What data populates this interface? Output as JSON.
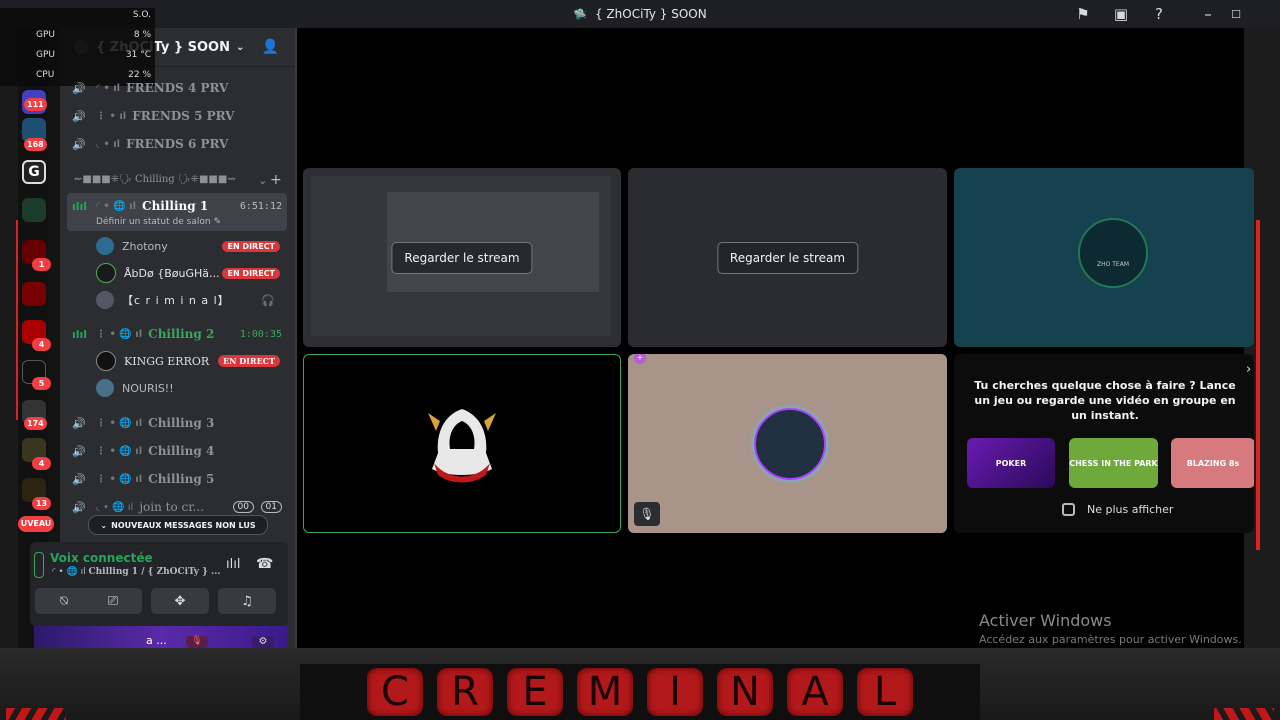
{
  "window": {
    "title": "{ ZhOCiTy } SOON"
  },
  "hardware_overlay": {
    "rows": [
      {
        "key": "",
        "value": "S.O."
      },
      {
        "key": "GPU",
        "value": "8 %"
      },
      {
        "key": "GPU",
        "value": "31 °C"
      },
      {
        "key": "CPU",
        "value": "22 %"
      }
    ]
  },
  "servers": {
    "badges": [
      "111",
      "168",
      "1",
      "4",
      "5",
      "174",
      "4",
      "13"
    ],
    "nouveau": "UVEAU"
  },
  "guild": {
    "name": "{ ZhOCiTy } SOON"
  },
  "channels": {
    "prv": [
      "FRENDS 4 PRV",
      "FRENDS 5 PRV",
      "FRENDS 6 PRV"
    ],
    "category": "⇜■■■⁜🗣 Chilling 🗣⁜■■■⇝",
    "chilling1": {
      "name": "Chilling 1",
      "time": "6:51:12",
      "status": "Définir un statut de salon"
    },
    "chilling1_users": [
      {
        "name": "Zhotony",
        "live": "EN DIRECT"
      },
      {
        "name": "ÅbDø {BøuGHä...",
        "live": "EN DIRECT"
      },
      {
        "name": "【c r i m i n a l】",
        "live": ""
      }
    ],
    "chilling2": {
      "name": "Chilling 2",
      "time": "1:00:35"
    },
    "chilling2_users": [
      {
        "name": "KINGG ERROR",
        "live": "EN DIRECT"
      },
      {
        "name": "NOURIS!!",
        "live": ""
      }
    ],
    "others": [
      "Chilling 3",
      "Chilling 4",
      "Chilling 5"
    ],
    "join": {
      "name": "join to cr...",
      "count1": "00",
      "count2": "01"
    },
    "unread": "NOUVEAUX MESSAGES NON LUS"
  },
  "voice": {
    "status": "Voix connectée",
    "channel": "Chilling 1 / { ZhOCiTy } ...",
    "profile_name": "a ..."
  },
  "stage": {
    "watch_label": "Regarder le stream",
    "activity_title": "Tu cherches quelque chose à faire ? Lance un jeu ou regarde une vidéo en groupe en un instant.",
    "games": [
      "POKER",
      "CHESS IN THE PARK",
      "BLAZING 8s"
    ],
    "dont_show": "Ne plus afficher",
    "zho_team": "ZHO TEAM"
  },
  "windows_watermark": {
    "title": "Activer Windows",
    "subtitle": "Accédez aux paramètres pour activer Windows."
  },
  "brand": {
    "letters": [
      "C",
      "R",
      "E",
      "M",
      "I",
      "N",
      "A",
      "L"
    ]
  }
}
